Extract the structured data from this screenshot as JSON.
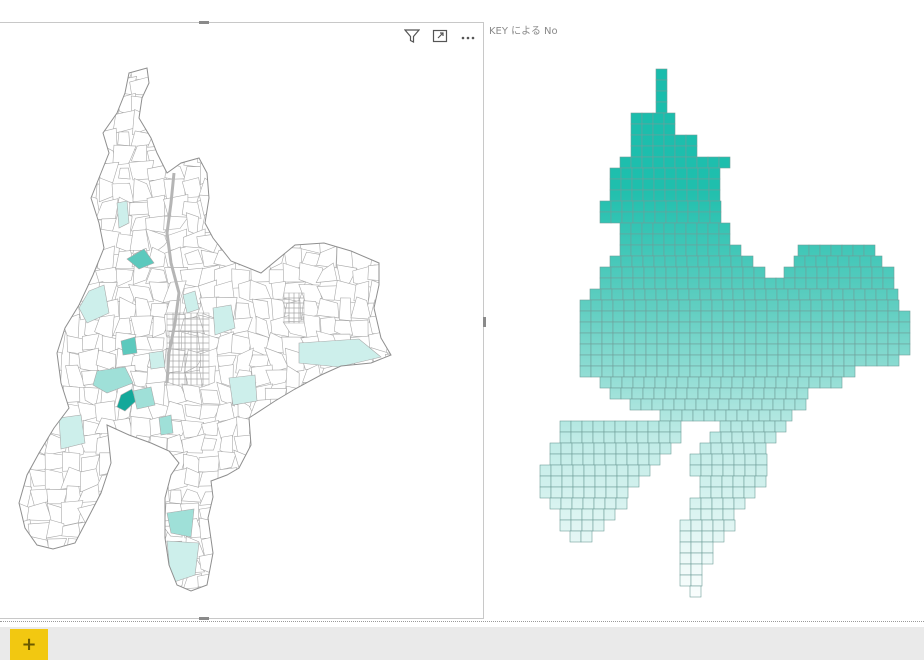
{
  "visuals": {
    "left_map": {
      "header_icons": [
        "filter-icon",
        "focus-mode-icon",
        "more-options-icon"
      ],
      "base_fill": "#ffffff",
      "stroke": "#a9a9a9",
      "highlight_colors": [
        "#cdefeb",
        "#9fe0d8",
        "#5cc9bd",
        "#14a89a"
      ]
    },
    "right_map": {
      "title": "KEY による No",
      "gradient_top": "#19bcac",
      "gradient_bottom": "#ffffff",
      "grid_stroke": "#6f9e99"
    }
  },
  "page_nav": {
    "add_label": "+",
    "accent": "#f2c811"
  }
}
